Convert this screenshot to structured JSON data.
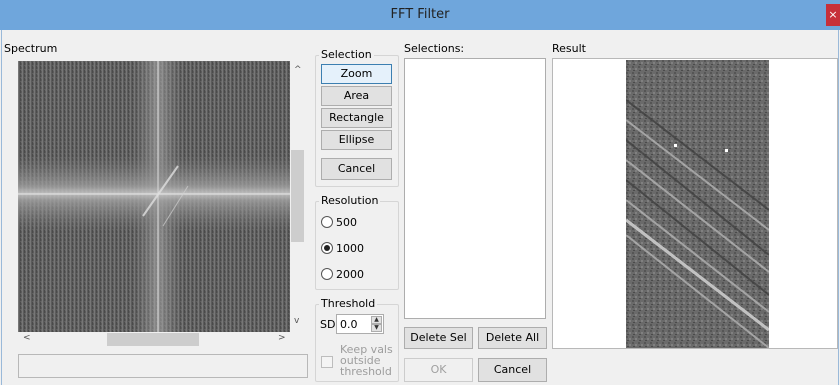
{
  "window": {
    "title": "FFT Filter",
    "close_icon": "×"
  },
  "spectrum": {
    "label": "Spectrum",
    "scroll_up": "^",
    "scroll_down": "v",
    "scroll_left": "<",
    "scroll_right": ">"
  },
  "selection": {
    "title": "Selection",
    "buttons": {
      "zoom": "Zoom",
      "area": "Area",
      "rectangle": "Rectangle",
      "ellipse": "Ellipse",
      "cancel": "Cancel"
    },
    "active": "Zoom"
  },
  "resolution": {
    "title": "Resolution",
    "options": [
      "500",
      "1000",
      "2000"
    ],
    "selected": "1000"
  },
  "threshold": {
    "title": "Threshold",
    "sd_label": "SD",
    "sd_value": "0.0",
    "keep_vals_lines": [
      "Keep vals",
      "outside",
      "threshold"
    ],
    "keep_vals_checked": false
  },
  "selections": {
    "label": "Selections:",
    "delete_sel": "Delete Sel",
    "delete_all": "Delete All"
  },
  "result": {
    "label": "Result"
  },
  "footer": {
    "ok": "OK",
    "cancel": "Cancel"
  }
}
